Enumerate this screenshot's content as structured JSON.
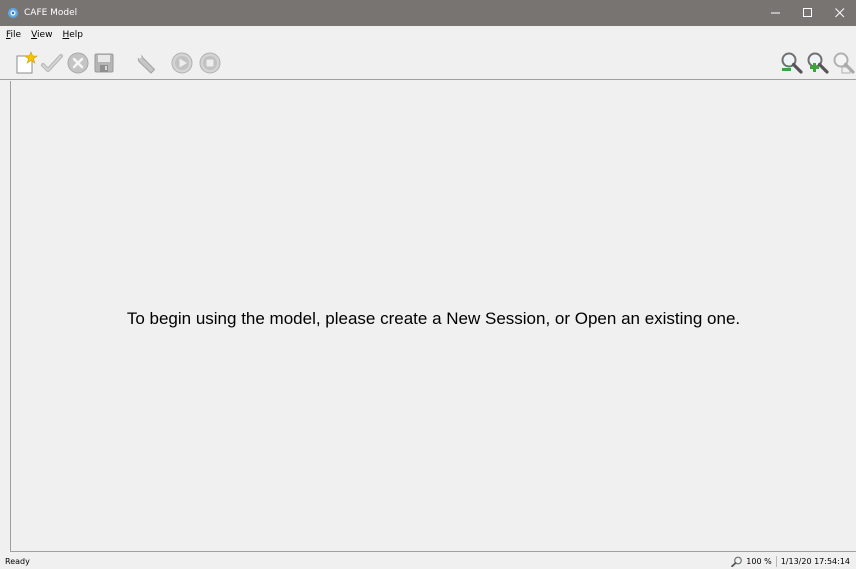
{
  "window": {
    "title": "CAFE Model",
    "app_icon": "cafe-app-icon",
    "controls": [
      "minimize-icon",
      "maximize-icon",
      "close-icon"
    ]
  },
  "menu": {
    "file": {
      "mnemonic": "F",
      "rest": "ile"
    },
    "view": {
      "mnemonic": "V",
      "rest": "iew"
    },
    "help": {
      "mnemonic": "H",
      "rest": "elp"
    }
  },
  "toolbar": {
    "left_icons": [
      "new-session-icon",
      "open-session-icon",
      "close-session-icon",
      "save-icon",
      "settings-wrench-icon",
      "run-icon",
      "stop-icon"
    ],
    "right_icons": [
      "zoom-out-icon",
      "zoom-in-icon",
      "zoom-reset-icon"
    ]
  },
  "main": {
    "message": "To begin using the model, please create a New Session, or Open an existing one."
  },
  "status": {
    "state": "Ready",
    "zoom": "100 %",
    "datetime": "1/13/20 17:54:14"
  },
  "colors": {
    "titlebar": "#777472",
    "background": "#f0f0f0",
    "new_icon_accent": "#f5c400",
    "zoom_in_accent": "#3aa63a"
  }
}
